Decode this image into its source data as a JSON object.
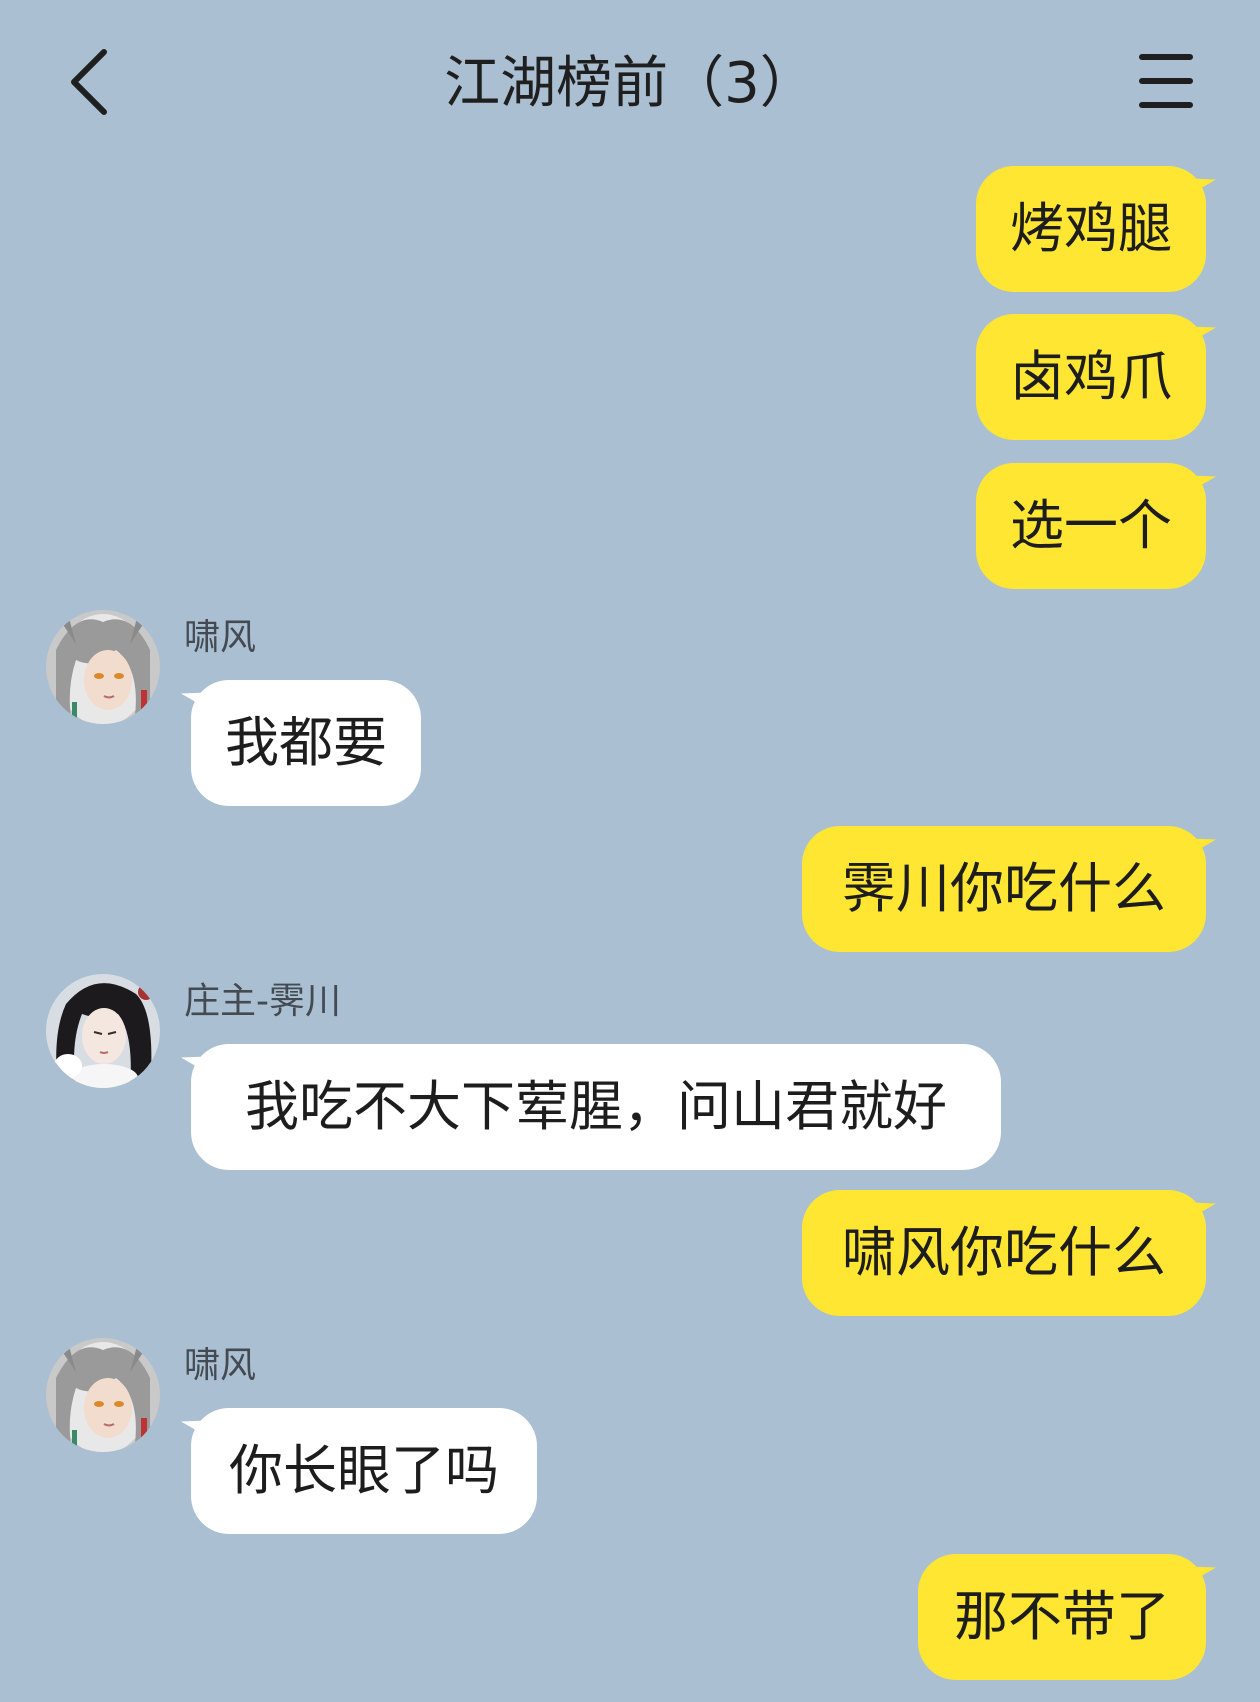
{
  "header": {
    "title": "江湖榜前（3）",
    "back_icon": "chevron-left-icon",
    "menu_icon": "hamburger-menu-icon"
  },
  "colors": {
    "background": "#aabfd2",
    "my_bubble": "#ffe633",
    "their_bubble": "#ffffff"
  },
  "messages": [
    {
      "from": "me",
      "text": "烤鸡腿"
    },
    {
      "from": "me",
      "text": "卤鸡爪"
    },
    {
      "from": "me",
      "text": "选一个"
    },
    {
      "from": "them",
      "sender": "啸风",
      "avatar": "avatar-xiaofeng",
      "text": "我都要"
    },
    {
      "from": "me",
      "text": "霁川你吃什么"
    },
    {
      "from": "them",
      "sender": "庄主-霁川",
      "avatar": "avatar-jichuan",
      "text": "我吃不大下荤腥，问山君就好"
    },
    {
      "from": "me",
      "text": "啸风你吃什么"
    },
    {
      "from": "them",
      "sender": "啸风",
      "avatar": "avatar-xiaofeng",
      "text": "你长眼了吗"
    },
    {
      "from": "me",
      "text": "那不带了"
    }
  ]
}
